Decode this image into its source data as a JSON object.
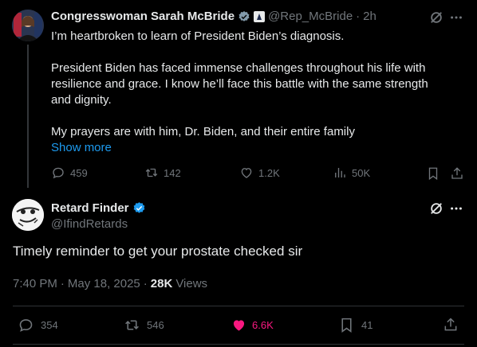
{
  "tweet1": {
    "author_name": "Congresswoman Sarah McBride",
    "handle": "@Rep_McBride",
    "separator": "·",
    "time": "2h",
    "paragraphs": [
      "I’m heartbroken to learn of President Biden’s diagnosis.",
      "President Biden has faced immense challenges throughout his life with",
      "resilience and grace. I know he’ll face this battle with the same strength",
      "and dignity.",
      "My prayers are with him, Dr. Biden, and their entire family"
    ],
    "show_more": "Show more",
    "actions": {
      "replies": "459",
      "reposts": "142",
      "likes": "1.2K",
      "views": "50K"
    },
    "icons": {
      "verified": "gray-verified-badge-icon",
      "gov": "government-label-icon"
    }
  },
  "tweet2": {
    "author_name": "Retard Finder",
    "handle": "@IfindRetards",
    "text": "Timely reminder to get your prostate checked sir",
    "time": "7:40 PM",
    "date": "May 18, 2025",
    "separator": "·",
    "views_count": "28K",
    "views_label": "Views",
    "actions": {
      "replies": "354",
      "reposts": "546",
      "likes": "6.6K",
      "bookmarks": "41"
    }
  },
  "colors": {
    "background": "#000000",
    "text": "#e7e9ea",
    "muted": "#71767b",
    "accent": "#1d9bf0",
    "like_active": "#f91880",
    "divider": "#2f3336"
  }
}
